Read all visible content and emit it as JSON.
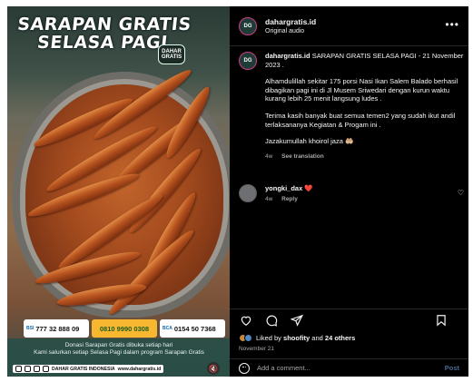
{
  "media": {
    "title_line1": "SARAPAN GRATIS",
    "title_line2": "SELASA PAGI",
    "logo_text": "DAHAR GRATIS",
    "banks": [
      {
        "name": "BSI",
        "account": "777 32 888 09"
      },
      {
        "name": "MANDIRI",
        "account": "0810 9990 0308"
      },
      {
        "name": "BCA",
        "account": "0154 50 7368"
      }
    ],
    "donasi_line1": "Donasi Sarapan Gratis dibuka setiap hari",
    "donasi_line2": "Kami salurkan setiap Selasa Pagi dalam program Sarapan Gratis",
    "footer_text": "DAHAR GRATIS INDONESIA",
    "footer_url": "www.dahargratis.id",
    "mute_icon": "🔇"
  },
  "header": {
    "username": "dahargratis.id",
    "subtitle": "Original audio",
    "more": "•••"
  },
  "caption": {
    "username": "dahargratis.id",
    "line1": "SARAPAN GRATIS SELASA PAGI - 21 November 2023 .",
    "para2": "Alhamdulillah sekitar 175 porsi Nasi Ikan Salem Balado berhasil dibagikan pagi ini di Jl Musem Sriwedari dengan kurun waktu kurang lebih 25 menit langsung ludes .",
    "para3": "Terima kasih banyak buat semua temen2 yang sudah ikut andil terlaksananya Kegiatan & Progam ini .",
    "para4": "Jazakumullah khoirol jaza 🤲🏼",
    "age": "4w",
    "see_translation": "See translation"
  },
  "comment": {
    "username": "yongki_dax",
    "text": "❤️",
    "age": "4w",
    "reply": "Reply"
  },
  "likes": {
    "prefix": "Liked by",
    "user": "shoofity",
    "and": "and",
    "others": "24 others"
  },
  "date": "November 21",
  "add_comment": {
    "placeholder": "Add a comment...",
    "post_label": "Post"
  },
  "colors": {
    "background": "#000000",
    "muted_text": "#a8a8a8",
    "post_button": "#4a6b96"
  }
}
